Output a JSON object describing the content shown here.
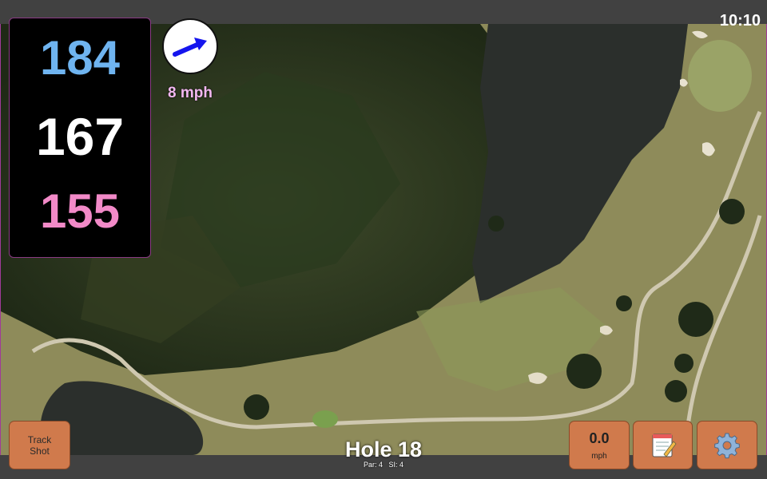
{
  "status": {
    "time": "10:10"
  },
  "distances": {
    "back": "184",
    "middle": "167",
    "front": "155"
  },
  "colors": {
    "back": "#6fb4f0",
    "middle": "#ffffff",
    "front": "#f28ac8",
    "button": "#d07a4c"
  },
  "wind": {
    "icon": "wind-arrow-icon",
    "speed": "8 mph"
  },
  "buttons": {
    "track_line1": "Track",
    "track_line2": "Shot",
    "speed_value": "0.0",
    "speed_unit": "mph",
    "notes_icon": "notepad-icon",
    "settings_icon": "gear-icon"
  },
  "hole": {
    "title": "Hole 18",
    "par": "Par: 4",
    "si": "SI: 4"
  }
}
